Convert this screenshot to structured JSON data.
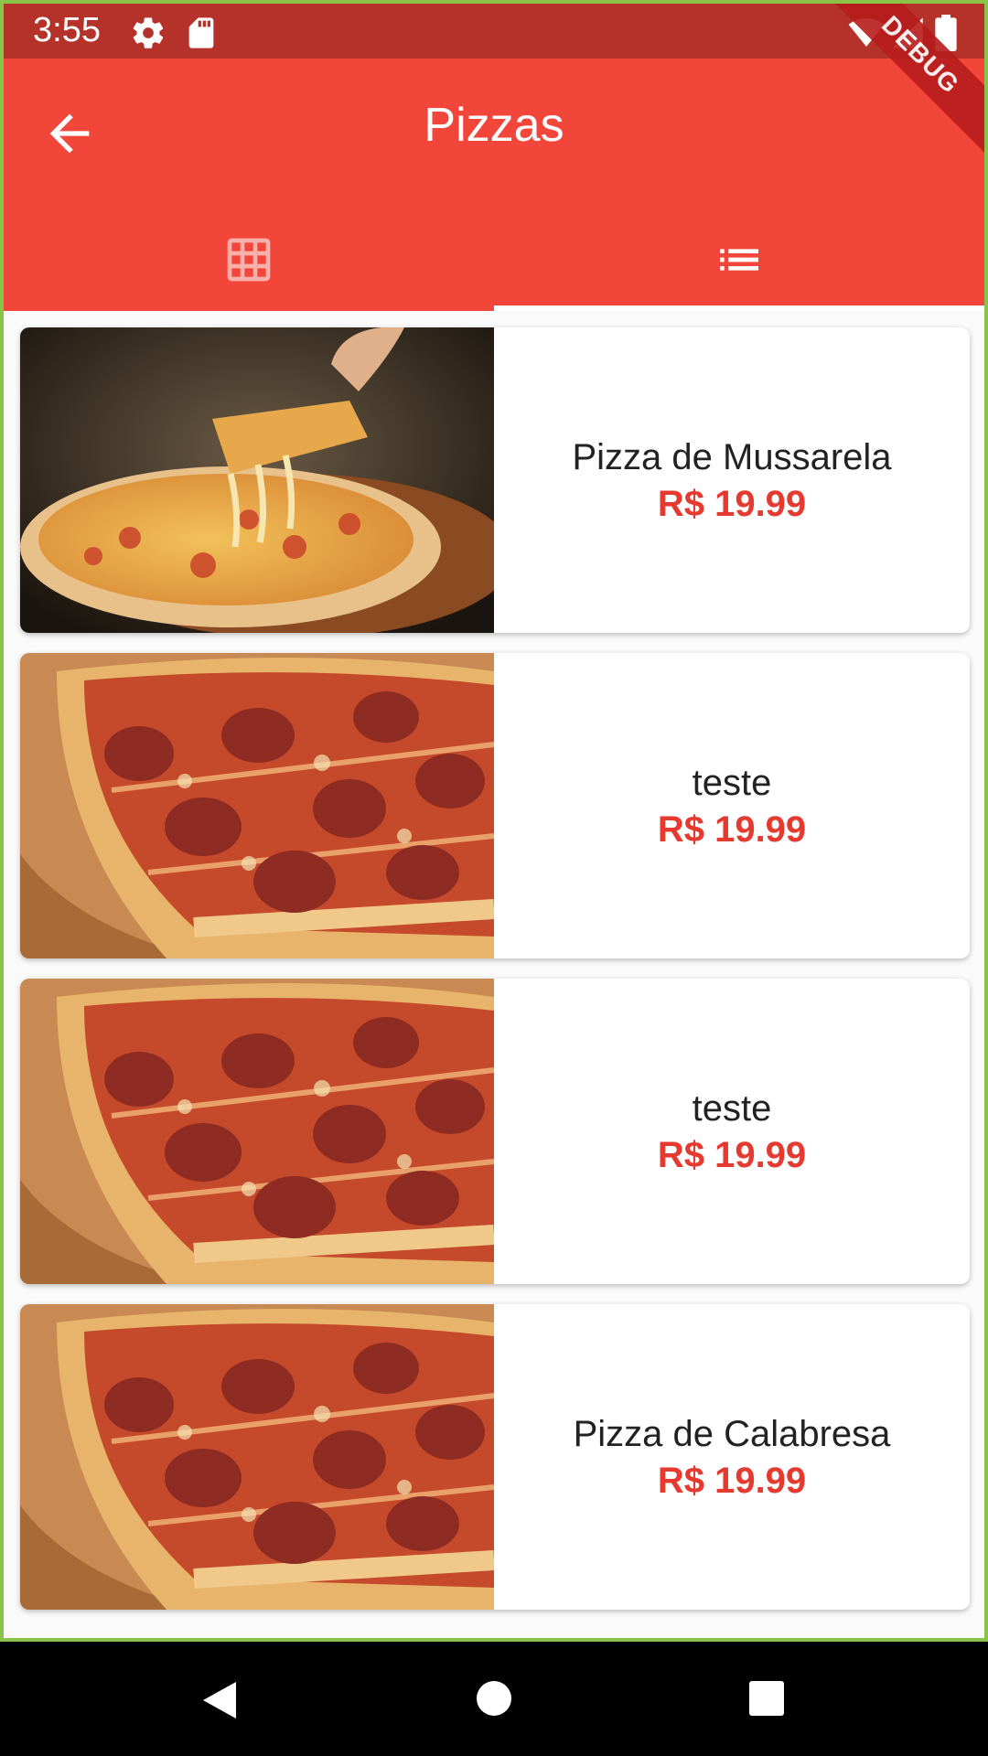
{
  "status_bar": {
    "time": "3:55",
    "icons": [
      "settings-icon",
      "sd-card-icon",
      "wifi-icon",
      "signal-icon",
      "battery-icon"
    ]
  },
  "debug_banner": "DEBUG",
  "app_bar": {
    "title": "Pizzas",
    "back_icon": "arrow-back-icon"
  },
  "tabs": [
    {
      "icon": "grid-icon",
      "selected": false
    },
    {
      "icon": "list-icon",
      "selected": true
    }
  ],
  "items": [
    {
      "name": "Pizza de Mussarela",
      "price": "R$ 19.99",
      "image": "mozzarella-pizza-photo"
    },
    {
      "name": "teste",
      "price": "R$ 19.99",
      "image": "pepperoni-pizza-photo"
    },
    {
      "name": "teste",
      "price": "R$ 19.99",
      "image": "pepperoni-pizza-photo"
    },
    {
      "name": "Pizza de Calabresa",
      "price": "R$ 19.99",
      "image": "pepperoni-pizza-photo"
    }
  ],
  "nav_bar": [
    "back-nav-icon",
    "home-nav-icon",
    "recents-nav-icon"
  ],
  "colors": {
    "app_bar": "#f2463b",
    "status_bar": "#b5322a",
    "price": "#e53a2f",
    "frame_border": "#8bc34a"
  }
}
